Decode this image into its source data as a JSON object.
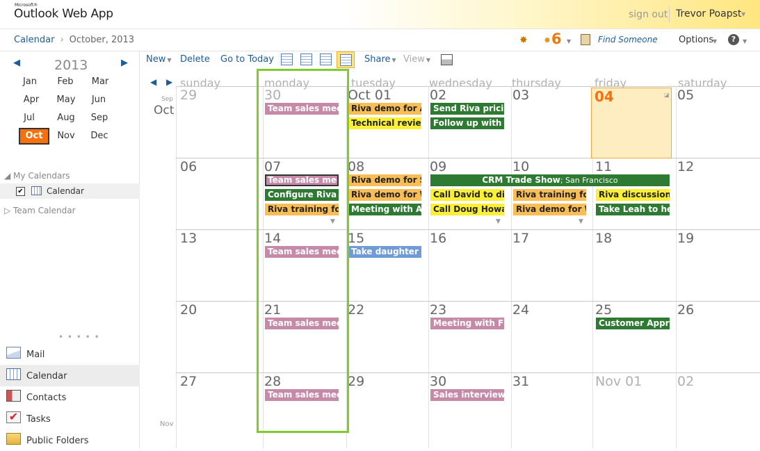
{
  "app": {
    "logo_small": "Microsoft®",
    "logo": "Outlook Web App",
    "sign_out": "sign out",
    "user": "Trevor Poapst"
  },
  "breadcrumb": {
    "root": "Calendar",
    "current": "October, 2013"
  },
  "header": {
    "alert_count": "6",
    "find_someone": "Find Someone",
    "options": "Options",
    "help": "?"
  },
  "mini_cal": {
    "year": "2013",
    "months": [
      "Jan",
      "Feb",
      "Mar",
      "Apr",
      "May",
      "Jun",
      "Jul",
      "Aug",
      "Sep",
      "Oct",
      "Nov",
      "Dec"
    ],
    "selected": "Oct"
  },
  "calendars": {
    "my_header": "My Calendars",
    "calendar": "Calendar",
    "team": "Team Calendar"
  },
  "nav": [
    {
      "label": "Mail",
      "icon": "mail-icon"
    },
    {
      "label": "Calendar",
      "icon": "calendar-icon"
    },
    {
      "label": "Contacts",
      "icon": "contacts-icon"
    },
    {
      "label": "Tasks",
      "icon": "tasks-icon"
    },
    {
      "label": "Public Folders",
      "icon": "folders-icon"
    }
  ],
  "toolbar": {
    "new": "New",
    "delete": "Delete",
    "goto": "Go to Today",
    "share": "Share",
    "view": "View"
  },
  "days": [
    "sunday",
    "monday",
    "tuesday",
    "wednesday",
    "thursday",
    "friday",
    "saturday"
  ],
  "month_labels": {
    "sep": "Sep",
    "oct": "Oct",
    "nov": "Nov"
  },
  "weeks": [
    [
      "29",
      "30",
      "Oct 01",
      "02",
      "03",
      "04",
      "05"
    ],
    [
      "06",
      "07",
      "08",
      "09",
      "10",
      "11",
      "12"
    ],
    [
      "13",
      "14",
      "15",
      "16",
      "17",
      "18",
      "19"
    ],
    [
      "20",
      "21",
      "22",
      "23",
      "24",
      "25",
      "26"
    ],
    [
      "27",
      "28",
      "29",
      "30",
      "31",
      "Nov 01",
      "02"
    ]
  ],
  "events": {
    "w0": [
      "Team sales meeting",
      "Riva demo for A",
      "Technical review",
      "Send Riva pricing",
      "Follow up with C"
    ],
    "w1": [
      "Team sales meeting",
      "Configure Riva t",
      "Riva training for",
      "Riva demo for S",
      "Riva demo for W",
      "Meeting with Al",
      "CRM Trade Show",
      "San Francisco",
      "Call David to dis",
      "Call Doug Howa",
      "Riva training for",
      "Riva demo for W",
      "Riva discussion w",
      "Take Leah to her"
    ],
    "w2": [
      "Team sales meeting",
      "Take daughter t"
    ],
    "w3": [
      "Team sales meeting",
      "Meeting with Fi",
      "Customer Appr"
    ],
    "w4": [
      "Team sales meeting",
      "Sales interview w"
    ]
  },
  "colors": {
    "today": "#f6700e",
    "pink": "#c68aa8",
    "orange": "#f8bd55",
    "yellow": "#fcf036",
    "green": "#2e7a32",
    "blue": "#6f9bd6",
    "highlight": "#7ecb29"
  }
}
